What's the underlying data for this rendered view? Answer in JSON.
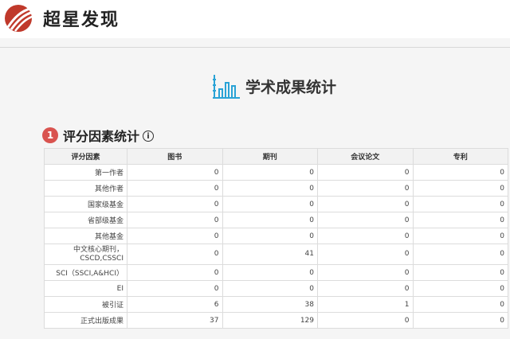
{
  "header": {
    "logo_text": "超星发现",
    "accent_color": "#c0392b"
  },
  "page_heading": {
    "title": "学术成果统计",
    "icon": "bar-chart-icon"
  },
  "section": {
    "number": "1",
    "title": "评分因素统计",
    "info_icon_glyph": "i",
    "badge_color": "#d9534f"
  },
  "table": {
    "headers": [
      "评分因素",
      "图书",
      "期刊",
      "会议论文",
      "专利"
    ],
    "rows": [
      {
        "label": "第一作者",
        "values": [
          "0",
          "0",
          "0",
          "0"
        ]
      },
      {
        "label": "其他作者",
        "values": [
          "0",
          "0",
          "0",
          "0"
        ]
      },
      {
        "label": "国家级基金",
        "values": [
          "0",
          "0",
          "0",
          "0"
        ]
      },
      {
        "label": "省部级基金",
        "values": [
          "0",
          "0",
          "0",
          "0"
        ]
      },
      {
        "label": "其他基金",
        "values": [
          "0",
          "0",
          "0",
          "0"
        ]
      },
      {
        "label": "中文核心期刊，CSCD,CSSCI",
        "values": [
          "0",
          "41",
          "0",
          "0"
        ],
        "tall": true
      },
      {
        "label": "SCI（SSCI,A&HCI）",
        "values": [
          "0",
          "0",
          "0",
          "0"
        ]
      },
      {
        "label": "EI",
        "values": [
          "0",
          "0",
          "0",
          "0"
        ]
      },
      {
        "label": "被引证",
        "values": [
          "6",
          "38",
          "1",
          "0"
        ]
      },
      {
        "label": "正式出版成果",
        "values": [
          "37",
          "129",
          "0",
          "0"
        ]
      }
    ]
  }
}
